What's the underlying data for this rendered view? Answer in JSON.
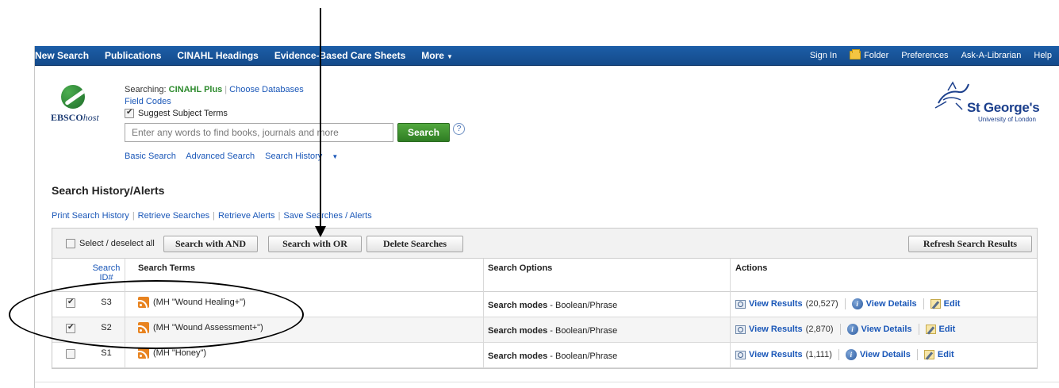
{
  "topnav": {
    "left": [
      {
        "label": "New Search"
      },
      {
        "label": "Publications"
      },
      {
        "label": "CINAHL Headings"
      },
      {
        "label": "Evidence-Based Care Sheets"
      },
      {
        "label": "More"
      }
    ],
    "right": [
      {
        "label": "Sign In"
      },
      {
        "label": "Folder"
      },
      {
        "label": "Preferences"
      },
      {
        "label": "Ask-A-Librarian"
      },
      {
        "label": "Help"
      }
    ]
  },
  "logo": {
    "brand_bold": "EBSCO",
    "brand_italic": "host"
  },
  "searching": {
    "prefix": "Searching:",
    "database": "CINAHL Plus",
    "choose": "Choose Databases",
    "field_codes": "Field Codes",
    "suggest": "Suggest Subject Terms",
    "suggest_checked": true
  },
  "search": {
    "placeholder": "Enter any words to find books, journals and more",
    "button": "Search",
    "help": "?"
  },
  "search_links": [
    "Basic Search",
    "Advanced Search",
    "Search History"
  ],
  "institution": {
    "name": "St George's",
    "sub": "University of London"
  },
  "history": {
    "title": "Search History/Alerts",
    "links": [
      "Print Search History",
      "Retrieve Searches",
      "Retrieve Alerts",
      "Save Searches / Alerts"
    ],
    "select_all": "Select / deselect all",
    "buttons": {
      "and": "Search with AND",
      "or": "Search with OR",
      "delete": "Delete Searches",
      "refresh": "Refresh Search Results"
    },
    "columns": {
      "id": "Search ID#",
      "terms": "Search Terms",
      "options": "Search Options",
      "actions": "Actions"
    },
    "rows": [
      {
        "id": "S3",
        "terms": "(MH \"Wound Healing+\")",
        "mode_label": "Search modes",
        "mode_value": "- Boolean/Phrase",
        "view": "View Results",
        "count": "(20,527)",
        "details": "View Details",
        "edit": "Edit",
        "checked": true
      },
      {
        "id": "S2",
        "terms": "(MH \"Wound Assessment+\")",
        "mode_label": "Search modes",
        "mode_value": "- Boolean/Phrase",
        "view": "View Results",
        "count": "(2,870)",
        "details": "View Details",
        "edit": "Edit",
        "checked": true
      },
      {
        "id": "S1",
        "terms": "(MH \"Honey\")",
        "mode_label": "Search modes",
        "mode_value": "- Boolean/Phrase",
        "view": "View Results",
        "count": "(1,111)",
        "details": "View Details",
        "edit": "Edit",
        "checked": false
      }
    ]
  },
  "colors": {
    "nav": "#1c5ea8",
    "search_button": "#3f9431",
    "database_name": "#2e8b2e",
    "link": "#1a57b8"
  }
}
